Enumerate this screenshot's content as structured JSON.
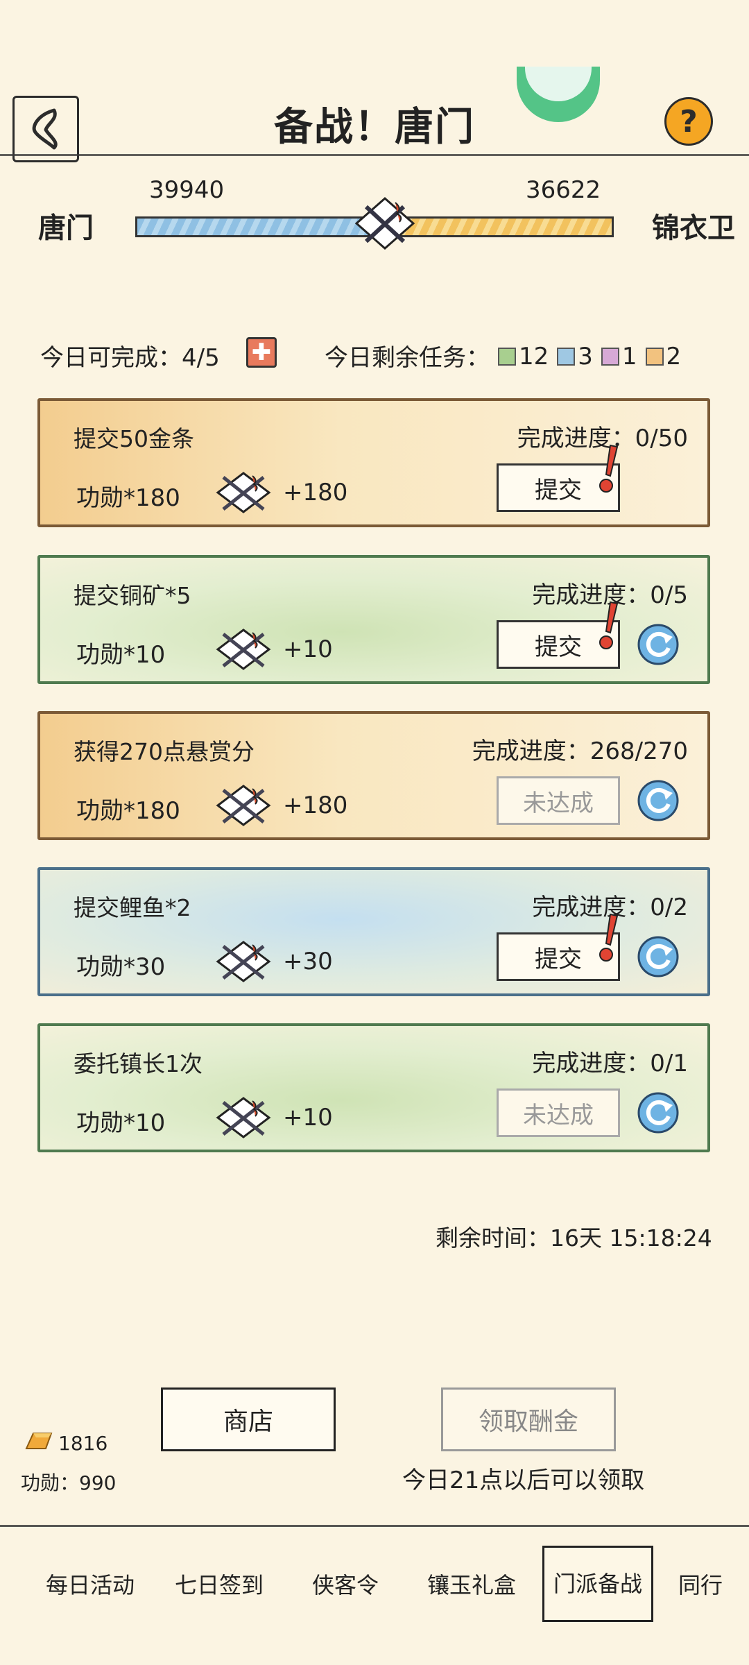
{
  "header": {
    "title": "备战！唐门",
    "help_label": "?"
  },
  "versus": {
    "left_faction": "唐门",
    "right_faction": "锦衣卫",
    "left_score": "39940",
    "right_score": "36622",
    "left_share": 0.522
  },
  "summary": {
    "today_complete_label": "今日可完成：",
    "today_complete_value": "4/5",
    "remaining_label": "今日剩余任务：",
    "remaining": [
      {
        "color": "#a8cf8f",
        "count": "12"
      },
      {
        "color": "#9fc8e3",
        "count": "3"
      },
      {
        "color": "#d7a9d6",
        "count": "1"
      },
      {
        "color": "#f2c27f",
        "count": "2"
      }
    ]
  },
  "tasks": [
    {
      "title": "提交50金条",
      "reward": "功勋*180",
      "bonus": "+180",
      "progress_label": "完成进度：",
      "progress": "0/50",
      "button": "提交",
      "enabled": true,
      "refresh": false,
      "theme": "gold"
    },
    {
      "title": "提交铜矿*5",
      "reward": "功勋*10",
      "bonus": "+10",
      "progress_label": "完成进度：",
      "progress": "0/5",
      "button": "提交",
      "enabled": true,
      "refresh": true,
      "theme": "green"
    },
    {
      "title": "获得270点悬赏分",
      "reward": "功勋*180",
      "bonus": "+180",
      "progress_label": "完成进度：",
      "progress": "268/270",
      "button": "未达成",
      "enabled": false,
      "refresh": true,
      "theme": "gold"
    },
    {
      "title": "提交鲤鱼*2",
      "reward": "功勋*30",
      "bonus": "+30",
      "progress_label": "完成进度：",
      "progress": "0/2",
      "button": "提交",
      "enabled": true,
      "refresh": true,
      "theme": "blue"
    },
    {
      "title": "委托镇长1次",
      "reward": "功勋*10",
      "bonus": "+10",
      "progress_label": "完成进度：",
      "progress": "0/1",
      "button": "未达成",
      "enabled": false,
      "refresh": true,
      "theme": "green"
    }
  ],
  "timer": {
    "label": "剩余时间：",
    "value": "16天 15:18:24"
  },
  "footer": {
    "shop_label": "商店",
    "claim_label": "领取酬金",
    "claim_note": "今日21点以后可以领取",
    "gold_count": "1816",
    "merit_label": "功勋：",
    "merit_value": "990"
  },
  "tabs": [
    {
      "label": "每日活动",
      "active": false
    },
    {
      "label": "七日签到",
      "active": false
    },
    {
      "label": "侠客令",
      "active": false
    },
    {
      "label": "镶玉礼盒",
      "active": false
    },
    {
      "label": "门派备战",
      "active": true
    },
    {
      "label": "同行",
      "active": false
    }
  ]
}
